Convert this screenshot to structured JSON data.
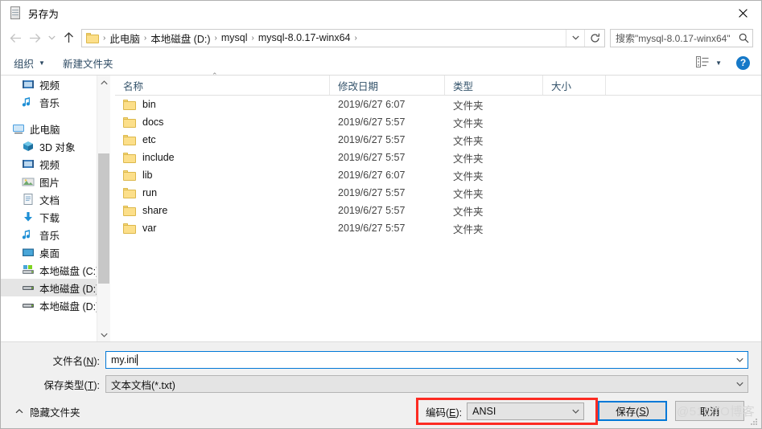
{
  "window": {
    "title": "另存为",
    "title_icon": "notepad-icon",
    "close_label": "✕"
  },
  "nav": {
    "back_icon": "arrow-left-icon",
    "forward_icon": "arrow-right-icon",
    "recent_icon": "chevron-down-icon",
    "up_icon": "arrow-up-icon",
    "folder_icon": "folder-icon",
    "breadcrumbs": [
      "此电脑",
      "本地磁盘 (D:)",
      "mysql",
      "mysql-8.0.17-winx64"
    ],
    "separator": "›",
    "dropdown_icon": "chevron-down-icon",
    "refresh_icon": "refresh-icon",
    "refresh_glyph": "↻"
  },
  "search": {
    "placeholder": "搜索\"mysql-8.0.17-winx64\"",
    "icon": "search-icon"
  },
  "toolbar": {
    "organize_label": "组织",
    "organize_caret": "▼",
    "new_folder_label": "新建文件夹",
    "view_icon": "view-layout-icon",
    "view_caret": "▼",
    "help_label": "?",
    "help_icon": "help-icon"
  },
  "sidebar": {
    "groups": [
      {
        "items": [
          {
            "label": "视频",
            "icon": "videos-icon",
            "indent": true,
            "selected": false
          },
          {
            "label": "音乐",
            "icon": "music-icon",
            "indent": true,
            "selected": false
          }
        ]
      },
      {
        "items": [
          {
            "label": "此电脑",
            "icon": "this-pc-icon",
            "indent": false,
            "selected": false
          },
          {
            "label": "3D 对象",
            "icon": "3d-objects-icon",
            "indent": true,
            "selected": false
          },
          {
            "label": "视频",
            "icon": "videos-icon",
            "indent": true,
            "selected": false
          },
          {
            "label": "图片",
            "icon": "pictures-icon",
            "indent": true,
            "selected": false
          },
          {
            "label": "文档",
            "icon": "documents-icon",
            "indent": true,
            "selected": false
          },
          {
            "label": "下载",
            "icon": "downloads-icon",
            "indent": true,
            "selected": false
          },
          {
            "label": "音乐",
            "icon": "music-icon",
            "indent": true,
            "selected": false
          },
          {
            "label": "桌面",
            "icon": "desktop-icon",
            "indent": true,
            "selected": false
          },
          {
            "label": "本地磁盘 (C:)",
            "icon": "system-drive-icon",
            "indent": true,
            "selected": false
          },
          {
            "label": "本地磁盘 (D:)",
            "icon": "drive-icon",
            "indent": true,
            "selected": true
          },
          {
            "label": "本地磁盘 (D:)",
            "icon": "drive-icon",
            "indent": true,
            "selected": false
          }
        ]
      }
    ],
    "scroll_up_icon": "chevron-up-icon",
    "scroll_down_icon": "chevron-down-icon"
  },
  "filelist": {
    "columns": [
      "名称",
      "修改日期",
      "类型",
      "大小"
    ],
    "sort_caret": "⌃",
    "rows": [
      {
        "name": "bin",
        "date": "2019/6/27 6:07",
        "type": "文件夹",
        "size": ""
      },
      {
        "name": "docs",
        "date": "2019/6/27 5:57",
        "type": "文件夹",
        "size": ""
      },
      {
        "name": "etc",
        "date": "2019/6/27 5:57",
        "type": "文件夹",
        "size": ""
      },
      {
        "name": "include",
        "date": "2019/6/27 5:57",
        "type": "文件夹",
        "size": ""
      },
      {
        "name": "lib",
        "date": "2019/6/27 6:07",
        "type": "文件夹",
        "size": ""
      },
      {
        "name": "run",
        "date": "2019/6/27 5:57",
        "type": "文件夹",
        "size": ""
      },
      {
        "name": "share",
        "date": "2019/6/27 5:57",
        "type": "文件夹",
        "size": ""
      },
      {
        "name": "var",
        "date": "2019/6/27 5:57",
        "type": "文件夹",
        "size": ""
      }
    ]
  },
  "form": {
    "filename_label": "文件名(N):",
    "filename_label_pre": "文件名(",
    "filename_label_key": "N",
    "filename_label_post": "):",
    "filename_value": "my.ini",
    "savetype_label_pre": "保存类型(",
    "savetype_label_key": "T",
    "savetype_label_post": "):",
    "savetype_value": "文本文档(*.txt)",
    "combo_caret": "⌄"
  },
  "actions": {
    "hide_folders_label": "隐藏文件夹",
    "hide_folders_caret": "⌃",
    "encoding_label_pre": "编码(",
    "encoding_label_key": "E",
    "encoding_label_post": "):",
    "encoding_value": "ANSI",
    "encoding_caret": "⌄",
    "save_label_pre": "保存(",
    "save_label_key": "S",
    "save_label_post": ")",
    "cancel_label": "取消",
    "highlight_color": "#fc2b22",
    "focus_color": "#0078d7"
  },
  "watermark": {
    "text": "@51CTO博客"
  }
}
